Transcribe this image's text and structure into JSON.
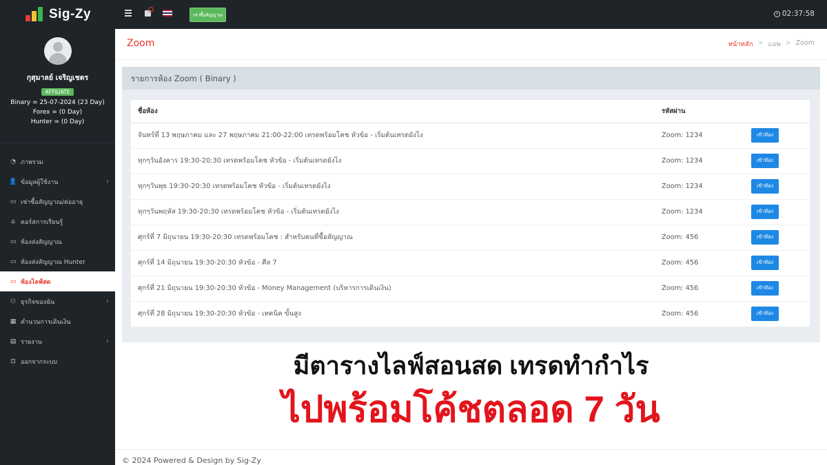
{
  "brand": {
    "name": "Sig-Zy"
  },
  "profile": {
    "name": "กุสุมาลย์ เจริญเชตร",
    "badge": "AFFILIATE",
    "binary": "Binary = 25-07-2024 (23 Day)",
    "forex": "Forex = (0 Day)",
    "hunter": "Hunter = (0 Day)"
  },
  "menu": [
    {
      "label": "ภาพรวม",
      "icon": "dashboard-icon",
      "arrow": false,
      "active": false
    },
    {
      "label": "ข้อมูลผู้ใช้งาน",
      "icon": "user-icon",
      "arrow": true,
      "active": false
    },
    {
      "label": "เช่าซื้อสัญญาณ/ต่ออายุ",
      "icon": "wallet-icon",
      "arrow": false,
      "active": false
    },
    {
      "label": "คอร์สการเรียนรู้",
      "icon": "graduation-icon",
      "arrow": false,
      "active": false
    },
    {
      "label": "ห้องส่งสัญญาณ",
      "icon": "monitor-icon",
      "arrow": false,
      "active": false
    },
    {
      "label": "ห้องส่งสัญญาณ Hunter",
      "icon": "monitor-icon",
      "arrow": false,
      "active": false
    },
    {
      "label": "ห้องไลฟ์สด",
      "icon": "monitor-icon",
      "arrow": false,
      "active": true
    },
    {
      "label": "ธุรกิจของฉัน",
      "icon": "users-icon",
      "arrow": true,
      "active": false
    },
    {
      "label": "คำนวนการเดินเงิน",
      "icon": "calculator-icon",
      "arrow": false,
      "active": false
    },
    {
      "label": "รายงาน",
      "icon": "report-icon",
      "arrow": true,
      "active": false
    },
    {
      "label": "ออกจากระบบ",
      "icon": "lock-icon",
      "arrow": false,
      "active": false
    }
  ],
  "topbar": {
    "buy_label": "เช่าซื้อสัญญาณ",
    "time": "02:37:58"
  },
  "header": {
    "title": "Zoom",
    "breadcrumb": [
      "หน้าหลัก",
      "แอพ",
      "Zoom"
    ]
  },
  "card": {
    "title": "รายการห้อง Zoom ( Binary )",
    "columns": [
      "ชื่อห้อง",
      "รหัสผ่าน",
      ""
    ],
    "join_label": "เข้าห้อง",
    "rows": [
      {
        "name": "จันทร์ที่ 13 พฤษภาคม และ 27 พฤษภาคม 21:00-22:00 เทรดพร้อมโคช หัวข้อ - เริ่มต้นเทรดยังไง",
        "password": "Zoom: 1234"
      },
      {
        "name": "ทุกๆวันอังคาร 19:30-20:30 เทรดพร้อมโคช หัวข้อ - เริ่มต้นเทรดยังไง",
        "password": "Zoom: 1234"
      },
      {
        "name": "ทุกๆวันพุธ 19:30-20:30 เทรดพร้อมโคช หัวข้อ - เริ่มต้นเทรดยังไง",
        "password": "Zoom: 1234"
      },
      {
        "name": "ทุกๆวันพฤหัส 19:30-20:30 เทรดพร้อมโคช หัวข้อ - เริ่มต้นเทรดยังไง",
        "password": "Zoom: 1234"
      },
      {
        "name": "ศุกร์ที่ 7 มิถุนายน 19:30-20:30 เทรดพร้อมโคช : สำหรับคนที่ซื้อสัญญาณ",
        "password": "Zoom: 456"
      },
      {
        "name": "ศุกร์ที่ 14 มิถุนายน 19:30-20:30 หัวข้อ - ศีล 7",
        "password": "Zoom: 456"
      },
      {
        "name": "ศุกร์ที่ 21 มิถุนายน 19:30-20:30 หัวข้อ - Money Management (บริหารการเดินเงิน)",
        "password": "Zoom: 456"
      },
      {
        "name": "ศุกร์ที่ 28 มิถุนายน 19:30-20:30 หัวข้อ - เทคนิค ขั้นสูง",
        "password": "Zoom: 456"
      }
    ]
  },
  "promo": {
    "line1": "มีตารางไลฟ์สอนสด เทรดทำกำไร",
    "line2": "ไปพร้อมโค้ชตลอด 7 วัน"
  },
  "footer": {
    "text": "© 2024 Powered & Design by Sig-Zy"
  },
  "colors": {
    "accent": "#e8372c",
    "sidebar": "#1f2429",
    "join": "#1e88e5",
    "success": "#5cb85c"
  }
}
